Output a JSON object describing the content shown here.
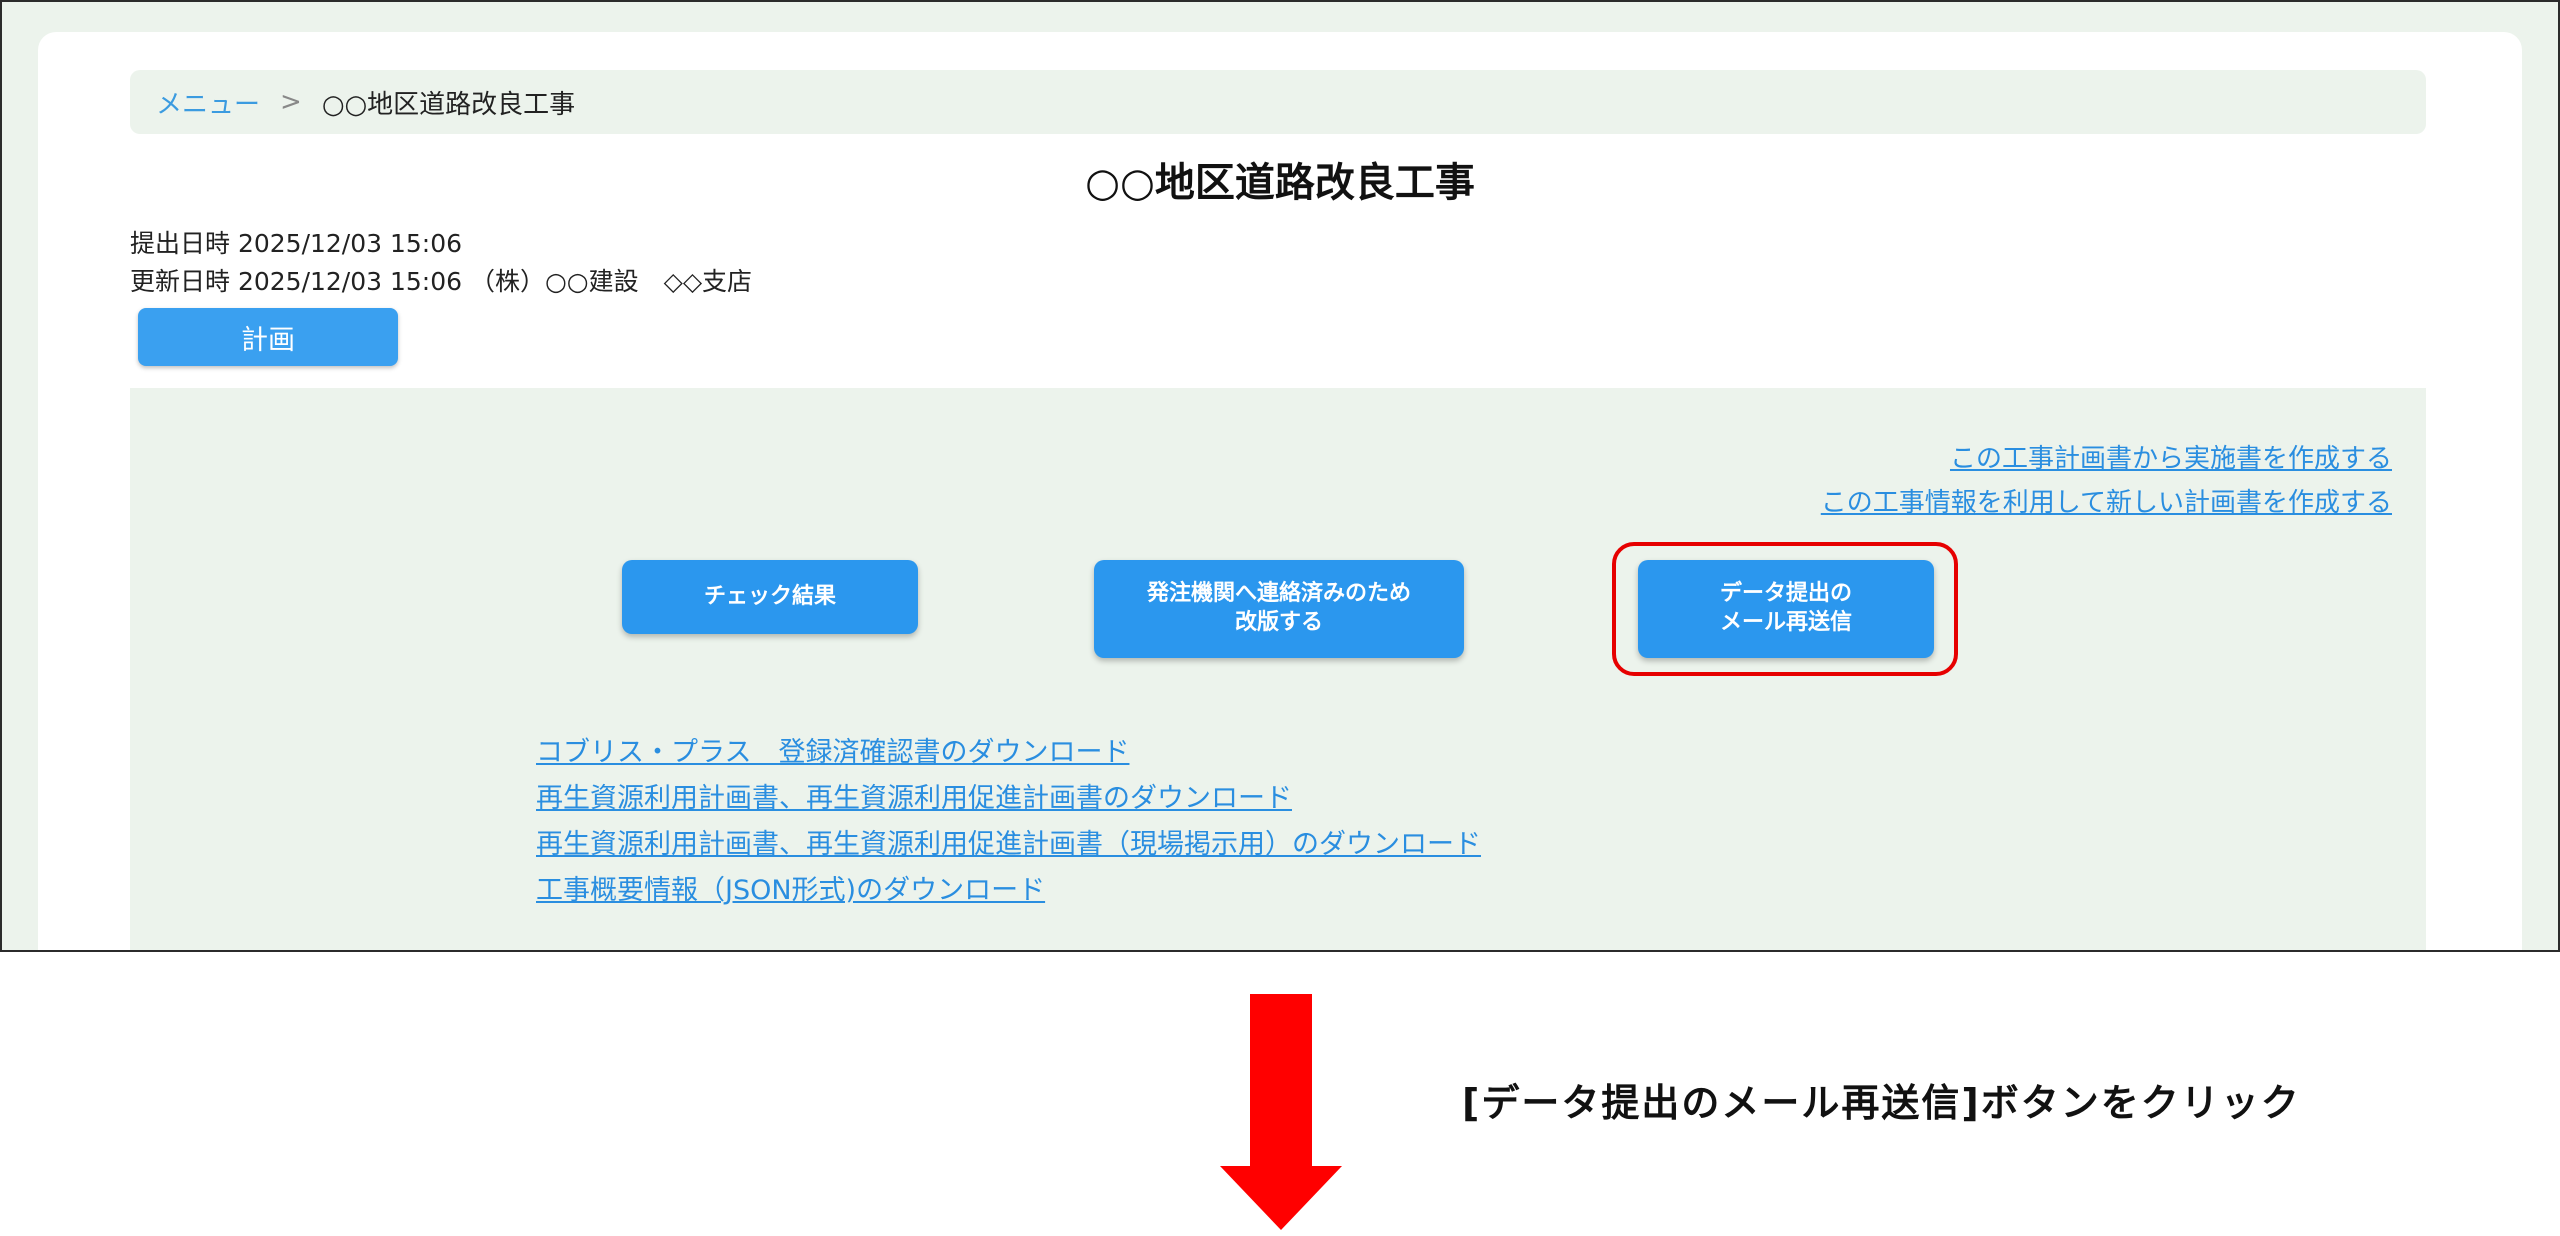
{
  "breadcrumb": {
    "menu_link": "メニュー",
    "separator": ">",
    "current": "○○地区道路改良工事"
  },
  "page_title": "○○地区道路改良工事",
  "meta": {
    "submitted": "提出日時 2025/12/03 15:06",
    "updated": "更新日時 2025/12/03 15:06 （株）○○建設　◇◇支店"
  },
  "tabs": {
    "plan": "計画"
  },
  "links": {
    "create_execution": "この工事計画書から実施書を作成する",
    "create_new_plan": "この工事情報を利用して新しい計画書を作成する"
  },
  "buttons": {
    "check_result": "チェック結果",
    "revise": "発注機関へ連絡済みのため\n改版する",
    "resend_mail": "データ提出の\nメール再送信"
  },
  "downloads": [
    "コブリス・プラス　登録済確認書のダウンロード",
    "再生資源利用計画書、再生資源利用促進計画書のダウンロード",
    "再生資源利用計画書、再生資源利用促進計画書（現場掲示用）のダウンロード",
    "工事概要情報（JSON形式)のダウンロード"
  ],
  "instruction": "[データ提出のメール再送信]ボタンをクリック",
  "colors": {
    "accent_blue": "#2b97ee",
    "link_blue": "#2a8ee0",
    "highlight_red": "#e60000",
    "arrow_red": "#ff0000",
    "content_bg": "#ecf3ec"
  },
  "icons": {
    "down_arrow": "down-arrow-icon"
  }
}
